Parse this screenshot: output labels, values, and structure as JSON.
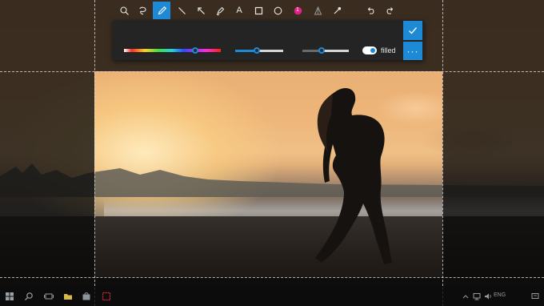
{
  "toolbar": {
    "tools": [
      {
        "name": "zoom-icon",
        "label": ""
      },
      {
        "name": "lasso-icon",
        "label": ""
      },
      {
        "name": "pen-icon",
        "label": "",
        "active": true
      },
      {
        "name": "line-icon",
        "label": ""
      },
      {
        "name": "arrow-icon",
        "label": ""
      },
      {
        "name": "marker-icon",
        "label": ""
      },
      {
        "name": "text-tool",
        "label": "A"
      },
      {
        "name": "rectangle-icon",
        "label": ""
      },
      {
        "name": "ellipse-icon",
        "label": ""
      },
      {
        "name": "step-number-tool",
        "label": "1"
      },
      {
        "name": "blur-icon",
        "label": ""
      },
      {
        "name": "color-picker-icon",
        "label": ""
      },
      {
        "name": "undo-icon",
        "label": ""
      },
      {
        "name": "redo-icon",
        "label": ""
      }
    ],
    "confirm_icon": "check-icon",
    "more_label": "···",
    "filled_label": "filled",
    "filled_on": true,
    "color_position": 0.74,
    "size_value": 0.45,
    "opacity_value": 0.42
  },
  "taskbar": {
    "icons": [
      "windows-start-icon",
      "search-icon",
      "task-view-icon",
      "file-explorer-icon",
      "store-icon",
      "screenshot-app-icon"
    ],
    "tray_language": "ENG",
    "tray_icons": [
      "chevron-up-icon",
      "network-icon",
      "volume-icon",
      "notifications-icon"
    ]
  },
  "colors": {
    "accent": "#1e8ad6",
    "toolbar_bg": "#242424",
    "step_badge": "#e0218a"
  }
}
